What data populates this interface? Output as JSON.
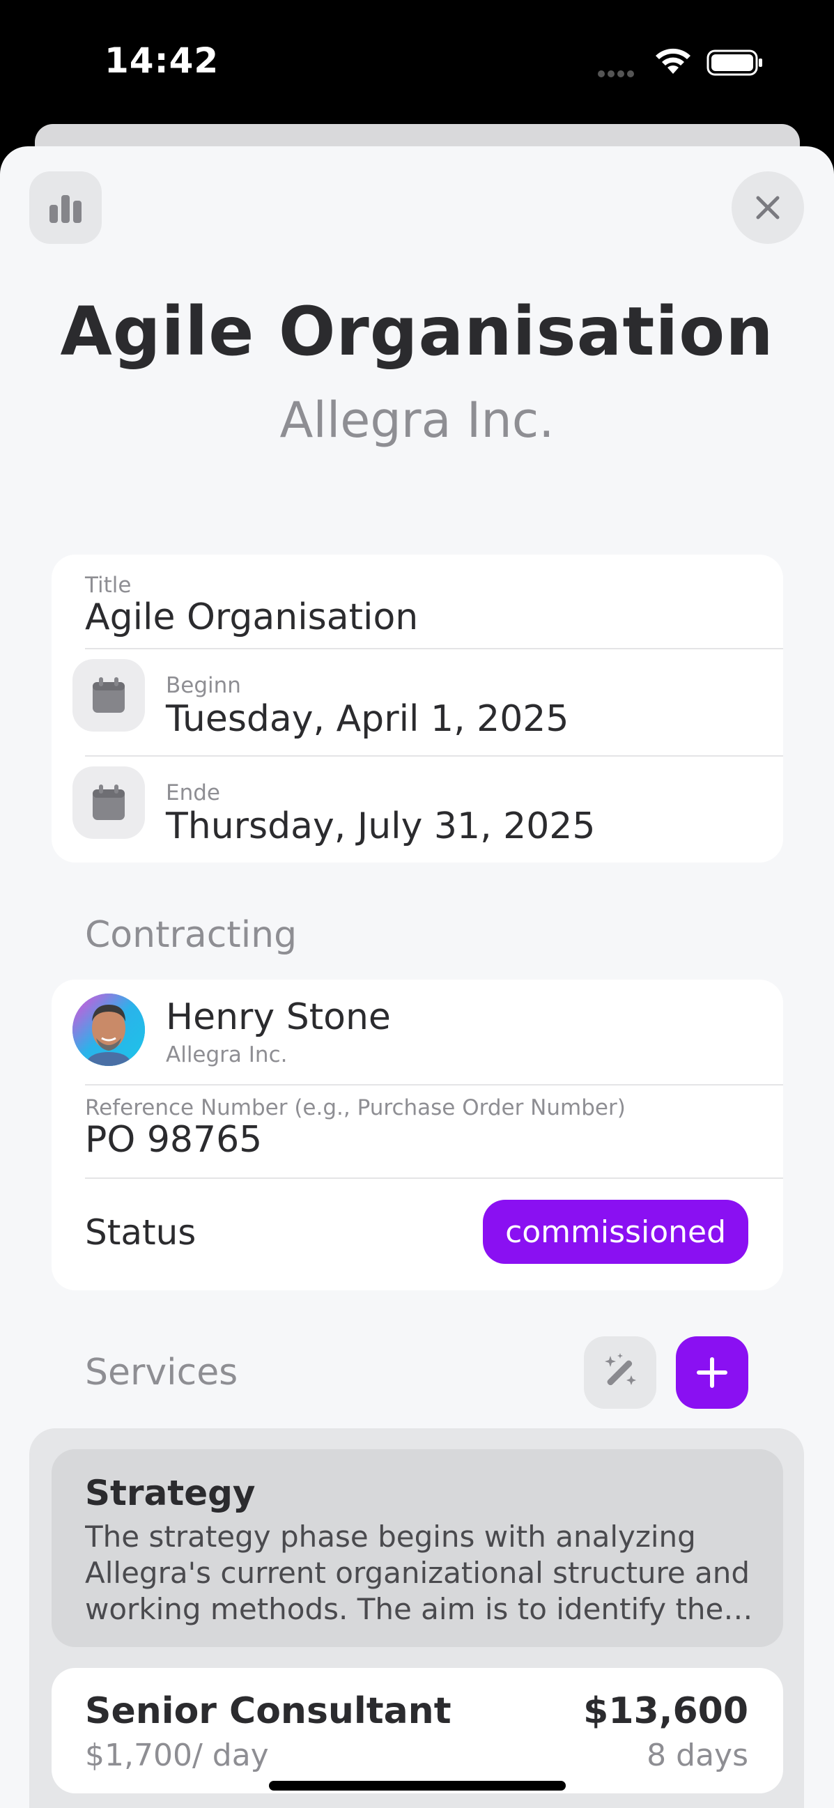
{
  "status_bar": {
    "time": "14:42"
  },
  "header": {
    "title": "Agile Organisation",
    "subtitle": "Allegra Inc."
  },
  "details": {
    "title_label": "Title",
    "title_value": "Agile Organisation",
    "begin_label": "Beginn",
    "begin_value": "Tuesday, April 1, 2025",
    "end_label": "Ende",
    "end_value": "Thursday, July 31, 2025"
  },
  "contracting": {
    "section_label": "Contracting",
    "contact_name": "Henry Stone",
    "contact_company": "Allegra Inc.",
    "reference_label": "Reference Number (e.g., Purchase Order Number)",
    "reference_value": "PO 98765",
    "status_label": "Status",
    "status_value": "commissioned",
    "status_color": "#8a10f2"
  },
  "services": {
    "section_label": "Services",
    "strategy": {
      "title": "Strategy",
      "description": "The strategy phase begins with analyzing Allegra's current organizational structure and working methods. The aim is to identify the…"
    },
    "roles": [
      {
        "name": "Senior Consultant",
        "rate": "$1,700/ day",
        "total": "$13,600",
        "days": "8 days"
      }
    ]
  },
  "icons": {
    "stats": "bar-chart-icon",
    "close": "close-icon",
    "calendar": "calendar-icon",
    "magic": "magic-wand-icon",
    "add": "plus-icon"
  },
  "colors": {
    "accent": "#8a10f2",
    "background": "#f6f7f9"
  }
}
